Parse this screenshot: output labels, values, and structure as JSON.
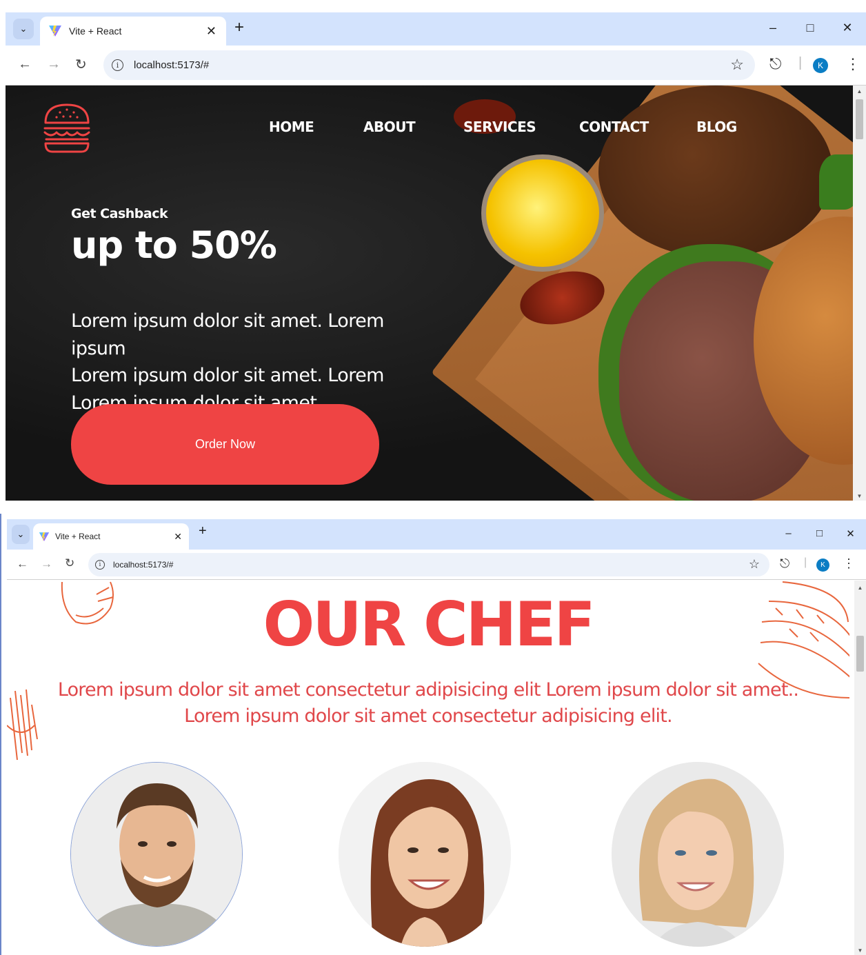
{
  "window1": {
    "tab_title": "Vite + React",
    "url": "localhost:5173/#",
    "profile_initial": "K",
    "nav": {
      "home": "HOME",
      "about": "ABOUT",
      "services": "SERVICES",
      "contact": "CONTACT",
      "blog": "BLOG"
    },
    "hero": {
      "kicker": "Get Cashback",
      "headline": "up to 50%",
      "lines": [
        "Lorem ipsum dolor sit amet. Lorem ipsum",
        "Lorem ipsum dolor sit amet. Lorem",
        "Lorem ipsum dolor sit amet."
      ],
      "cta": "Order Now"
    }
  },
  "window2": {
    "tab_title": "Vite + React",
    "url": "localhost:5173/#",
    "profile_initial": "K",
    "section_title": "OUR CHEF",
    "description_lines": [
      "Lorem ipsum dolor sit amet consectetur adipisicing elit Lorem ipsum dolor sit amet..",
      "Lorem ipsum dolor sit amet consectetur adipisicing elit."
    ]
  },
  "colors": {
    "accent": "#ef4444",
    "tabstrip": "#d3e3fd",
    "hero_bg": "#141414",
    "avatar": "#0b7dc4"
  },
  "icons": [
    "vite-icon",
    "close-icon",
    "plus-icon",
    "minimize-icon",
    "maximize-icon",
    "back-icon",
    "forward-icon",
    "reload-icon",
    "info-icon",
    "star-icon",
    "extensions-icon",
    "menu-dots-icon",
    "burger-logo-icon",
    "chevron-down-icon"
  ]
}
